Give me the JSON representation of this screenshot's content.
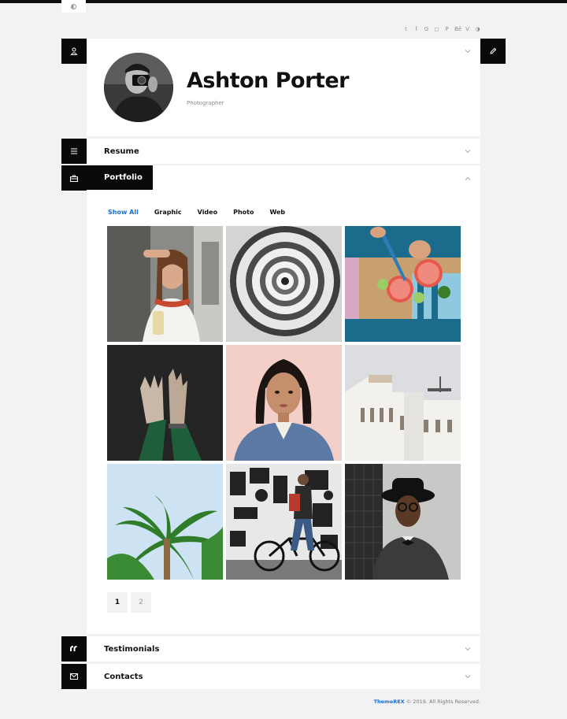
{
  "social_icons": [
    {
      "name": "twitter-icon",
      "glyph": "t"
    },
    {
      "name": "facebook-icon",
      "glyph": "f"
    },
    {
      "name": "google-icon",
      "glyph": "G"
    },
    {
      "name": "instagram-icon",
      "glyph": "◻"
    },
    {
      "name": "pinterest-icon",
      "glyph": "P"
    },
    {
      "name": "behance-icon",
      "glyph": "Bē"
    },
    {
      "name": "vimeo-icon",
      "glyph": "V"
    },
    {
      "name": "dribbble-icon",
      "glyph": "◑"
    }
  ],
  "profile": {
    "name": "Ashton Porter",
    "role": "Photographer"
  },
  "sections": {
    "resume": "Resume",
    "portfolio": "Portfolio",
    "testimonials": "Testimonials",
    "contacts": "Contacts"
  },
  "portfolio": {
    "filters": [
      "Show All",
      "Graphic",
      "Video",
      "Photo",
      "Web"
    ],
    "active_filter": "Show All",
    "images": [
      "woman-with-braids-photo",
      "spiral-staircase-photo",
      "grapefruit-cutting-photo",
      "hands-photo",
      "woman-denim-jacket-photo",
      "white-building-photo",
      "palm-tree-photo",
      "man-with-bicycle-photo",
      "man-with-hat-photo"
    ],
    "pages": [
      "1",
      "2"
    ],
    "current_page": "1"
  },
  "footer": {
    "brand": "ThemeREX",
    "text": " © 2019. All Rights Reserved."
  },
  "colors": {
    "accent": "#1a6ecf",
    "dark": "#0a0a0a",
    "background": "#f2f2f4"
  }
}
